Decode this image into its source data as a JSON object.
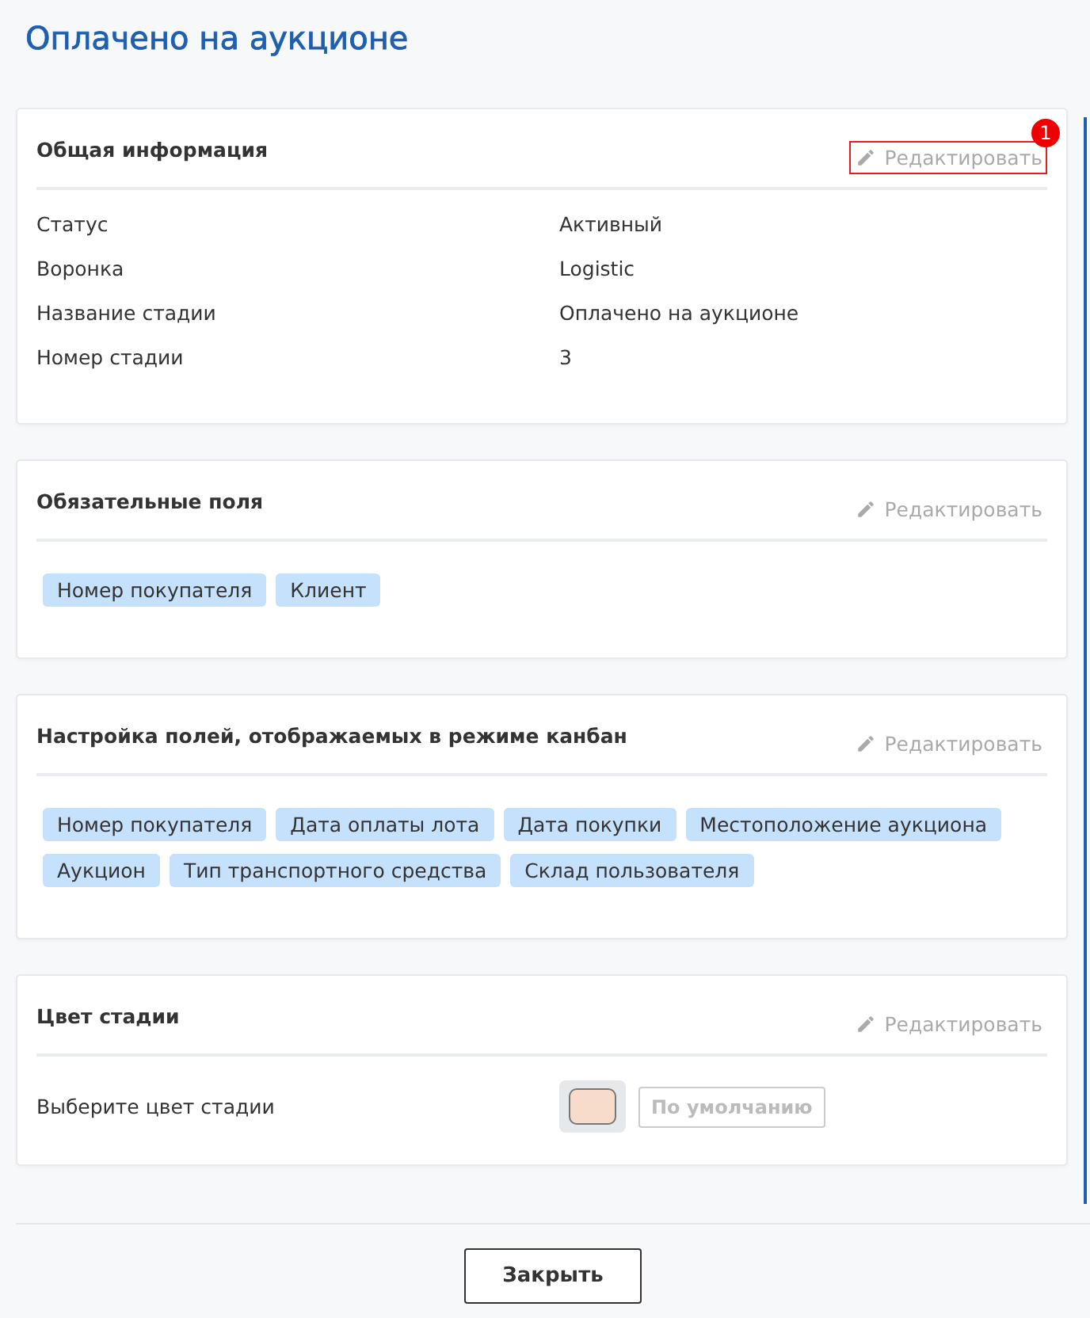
{
  "title": "Оплачено на аукционе",
  "sections": [
    {
      "kind": "info",
      "heading": "Общая информация",
      "edit": {
        "label": "Редактировать",
        "highlighted": true,
        "badge": "1"
      },
      "rows": [
        {
          "label": "Статус",
          "value": "Активный"
        },
        {
          "label": "Воронка",
          "value": "Logistic"
        },
        {
          "label": "Название стадии",
          "value": "Оплачено на аукционе"
        },
        {
          "label": "Номер стадии",
          "value": "3"
        }
      ]
    },
    {
      "kind": "tags",
      "heading": "Обязательные поля",
      "edit": {
        "label": "Редактировать",
        "highlighted": false
      },
      "tags": [
        "Номер покупателя",
        "Клиент"
      ]
    },
    {
      "kind": "tags",
      "heading": "Настройка полей, отображаемых в режиме канбан",
      "edit": {
        "label": "Редактировать",
        "highlighted": false
      },
      "tags": [
        "Номер покупателя",
        "Дата оплаты лота",
        "Дата покупки",
        "Местоположение аукциона",
        "Аукцион",
        "Тип транспортного средства",
        "Склад пользователя"
      ]
    },
    {
      "kind": "color",
      "heading": "Цвет стадии",
      "edit": {
        "label": "Редактировать",
        "highlighted": false
      },
      "label": "Выберите цвет стадии",
      "color": "#f8dccb",
      "default_button": "По умолчанию"
    }
  ],
  "close_button": "Закрыть"
}
